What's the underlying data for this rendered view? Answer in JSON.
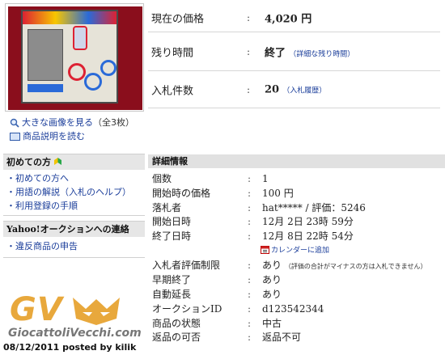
{
  "image_links": [
    {
      "label": "大きな画像を見る",
      "note": "（全3枚）",
      "icon": "magnifier-icon"
    },
    {
      "label": "商品説明を読む",
      "note": "",
      "icon": "book-icon"
    }
  ],
  "summary": [
    {
      "label": "現在の価格",
      "value": "4,020 円",
      "sub": ""
    },
    {
      "label": "残り時間",
      "value": "終了",
      "sub": "（詳細な残り時間）"
    },
    {
      "label": "入札件数",
      "value": "20",
      "sub": "（入札履歴）"
    }
  ],
  "sidebar": {
    "beginner_title": "初めての方",
    "beginner_links": [
      "初めての方へ",
      "用語の解説（入札のヘルプ）",
      "利用登録の手順"
    ],
    "contact_title": "Yahoo!オークションへの連絡",
    "contact_links": [
      "違反商品の申告"
    ]
  },
  "details": {
    "title": "詳細情報",
    "rows": [
      {
        "label": "個数",
        "value": "1",
        "note": ""
      },
      {
        "label": "開始時の価格",
        "value": "100 円",
        "note": ""
      },
      {
        "label": "落札者",
        "value": "hat***** / 評価：5246",
        "note": ""
      },
      {
        "label": "開始日時",
        "value": "12月 2日 23時 59分",
        "note": ""
      },
      {
        "label": "終了日時",
        "value": "12月 8日 22時 54分",
        "note": ""
      },
      {
        "label": "入札者評価制限",
        "value": "あり",
        "note": "（評価の合計がマイナスの方は入札できません）"
      },
      {
        "label": "早期終了",
        "value": "あり",
        "note": ""
      },
      {
        "label": "自動延長",
        "value": "あり",
        "note": ""
      },
      {
        "label": "オークションID",
        "value": "d123542344",
        "note": ""
      },
      {
        "label": "商品の状態",
        "value": "中古",
        "note": ""
      },
      {
        "label": "返品の可否",
        "value": "返品不可",
        "note": ""
      }
    ],
    "calendar_label": "カレンダーに追加"
  },
  "watermark": {
    "logo": "GV",
    "site": "GiocattoliVecchi.com",
    "posted": "08/12/2011 posted by kilik"
  },
  "colors": {
    "link": "#1a3d9a",
    "header_bg": "#e1e1e1",
    "watermark": "#e8a83c"
  }
}
